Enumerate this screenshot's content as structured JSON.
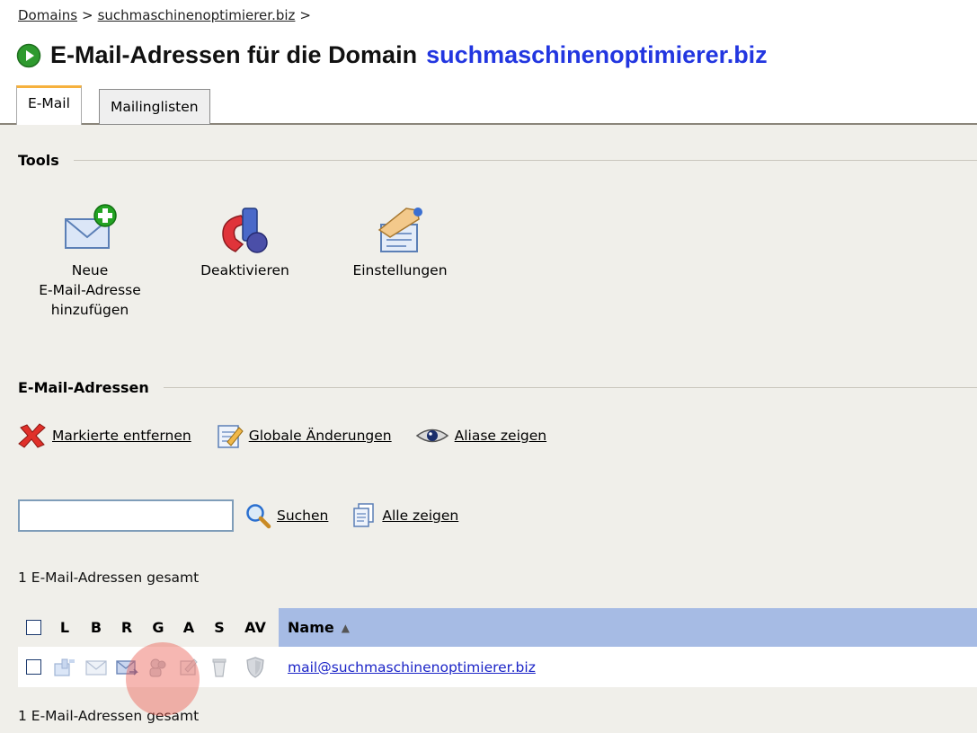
{
  "breadcrumb": {
    "domains": "Domains",
    "domain": "suchmaschinenoptimierer.biz",
    "sep1": ">",
    "sep2": ">"
  },
  "title": {
    "text": "E-Mail-Adressen für die Domain",
    "domain": "suchmaschinenoptimierer.biz"
  },
  "tabs": [
    {
      "label": "E-Mail",
      "active": true
    },
    {
      "label": "Mailinglisten",
      "active": false
    }
  ],
  "tools": {
    "heading": "Tools",
    "items": [
      {
        "label": "Neue E-Mail-Adresse hinzufügen",
        "icon": "envelope-add-icon"
      },
      {
        "label": "Deaktivieren",
        "icon": "deactivate-icon"
      },
      {
        "label": "Einstellungen",
        "icon": "settings-icon"
      }
    ]
  },
  "email_section": {
    "heading": "E-Mail-Adressen",
    "actions": {
      "remove": "Markierte entfernen",
      "global": "Globale Änderungen",
      "aliases": "Aliase zeigen"
    },
    "search": {
      "value": "",
      "button": "Suchen",
      "show_all": "Alle zeigen"
    },
    "count_top": "1 E-Mail-Adressen gesamt",
    "count_bottom": "1 E-Mail-Adressen gesamt"
  },
  "table": {
    "columns": {
      "l": "L",
      "b": "B",
      "r": "R",
      "g": "G",
      "a": "A",
      "s": "S",
      "av": "AV",
      "name": "Name",
      "sort": "▲"
    },
    "rows": [
      {
        "name": "mail@suchmaschinenoptimierer.biz"
      }
    ]
  },
  "colors": {
    "link_blue": "#2236e0",
    "header_blue": "#a6bbe4",
    "panel": "#f0efea",
    "tab_accent": "#f6b13d"
  }
}
